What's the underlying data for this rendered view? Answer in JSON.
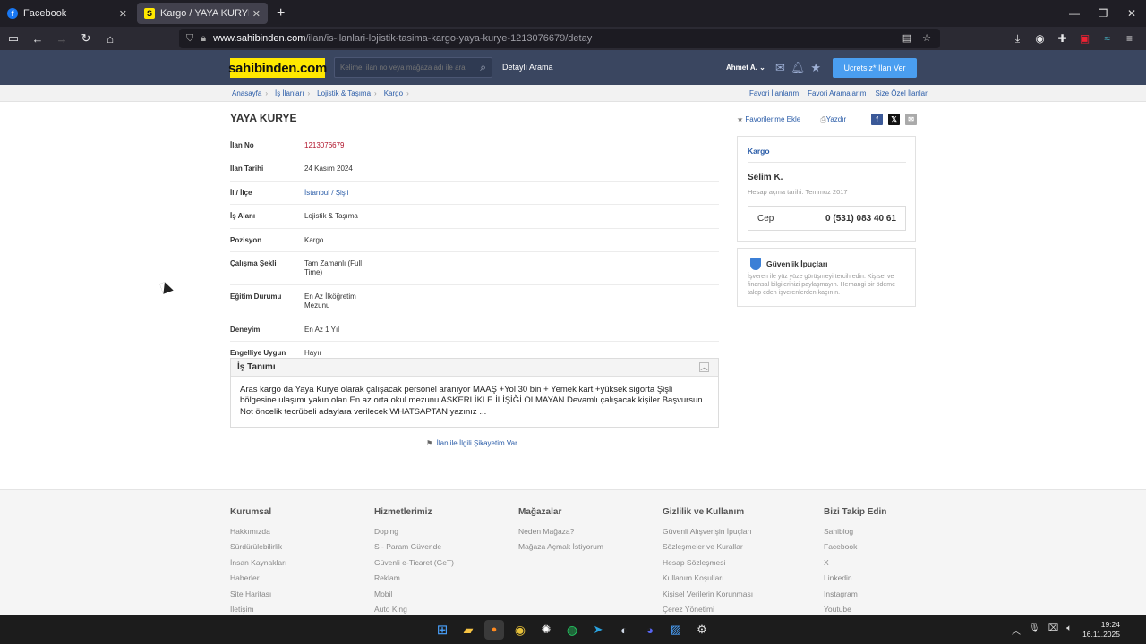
{
  "browser": {
    "tabs": [
      {
        "label": "Facebook",
        "favicon": "facebook-icon"
      },
      {
        "label": "Kargo / YAYA KURYE sahibinden",
        "favicon": "sahibinden-icon"
      }
    ],
    "url_host": "www.sahibinden.com",
    "url_path": "/ilan/is-ilanlari-lojistik-tasima-kargo-yaya-kurye-1213076679/detay"
  },
  "header": {
    "logo": "sahibinden.com",
    "search_placeholder": "Kelime, ilan no veya mağaza adı ile ara",
    "detailed_search": "Detaylı Arama",
    "user": "Ahmet A.",
    "post_ad": "Ücretsiz* İlan Ver"
  },
  "breadcrumb": [
    "Anasayfa",
    "İş İlanları",
    "Lojistik & Taşıma",
    "Kargo"
  ],
  "fav_links": [
    "Favori İlanlarım",
    "Favori Aramalarım",
    "Size Özel İlanlar"
  ],
  "listing": {
    "title": "YAYA KURYE",
    "add_favorite": "Favorilerime Ekle",
    "print": "Yazdır",
    "details": [
      {
        "key": "İlan No",
        "value": "1213076679"
      },
      {
        "key": "İlan Tarihi",
        "value": "24 Kasım 2024"
      },
      {
        "key": "İl / İlçe",
        "value": "İstanbul / Şişli"
      },
      {
        "key": "İş Alanı",
        "value": "Lojistik & Taşıma"
      },
      {
        "key": "Pozisyon",
        "value": "Kargo"
      },
      {
        "key": "Çalışma Şekli",
        "value": "Tam Zamanlı (Full Time)"
      },
      {
        "key": "Eğitim Durumu",
        "value": "En Az İlköğretim Mezunu"
      },
      {
        "key": "Deneyim",
        "value": "En Az 1 Yıl"
      },
      {
        "key": "Engelliye Uygun",
        "value": "Hayır"
      }
    ],
    "description_title": "İş Tanımı",
    "description": "Aras kargo da Yaya Kurye olarak çalışacak personel aranıyor MAAŞ +Yol 30 bin + Yemek kartı+yüksek sigorta Şişli bölgesine ulaşımı yakın olan En az orta okul mezunu ASKERLİKLE İLİŞİĞİ OLMAYAN Devamlı çalışacak kişiler Başvursun Not öncelik tecrübeli adaylara verilecek WHATSAPTAN yazınız ...",
    "complaint": "İlan ile İlgili Şikayetim Var"
  },
  "seller": {
    "category": "Kargo",
    "name": "Selim K.",
    "since": "Hesap açma tarihi: Temmuz 2017",
    "phone_label": "Cep",
    "phone": "0 (531) 083 40 61"
  },
  "safety": {
    "title": "Güvenlik İpuçları",
    "text": "İşveren ile yüz yüze görüşmeyi tercih edin. Kişisel ve finansal bilgilerinizi paylaşmayın. Herhangi bir ödeme talep eden işverenlerden kaçının."
  },
  "footer": [
    {
      "title": "Kurumsal",
      "links": [
        "Hakkımızda",
        "Sürdürülebilirlik",
        "İnsan Kaynakları",
        "Haberler",
        "Site Haritası",
        "İletişim"
      ]
    },
    {
      "title": "Hizmetlerimiz",
      "links": [
        "Doping",
        "S - Param Güvende",
        "Güvenli e-Ticaret (GeT)",
        "Reklam",
        "Mobil",
        "Auto King"
      ]
    },
    {
      "title": "Mağazalar",
      "links": [
        "Neden Mağaza?",
        "Mağaza Açmak İstiyorum"
      ]
    },
    {
      "title": "Gizlilik ve Kullanım",
      "links": [
        "Güvenli Alışverişin İpuçları",
        "Sözleşmeler ve Kurallar",
        "Hesap Sözleşmesi",
        "Kullanım Koşulları",
        "Kişisel Verilerin Korunması",
        "Çerez Yönetimi"
      ]
    },
    {
      "title": "Bizi Takip Edin",
      "links": [
        "Sahiblog",
        "Facebook",
        "X",
        "Linkedin",
        "Instagram",
        "Youtube"
      ]
    }
  ],
  "taskbar": {
    "time": "19:24",
    "date": "16.11.2025"
  },
  "colors": {
    "accent": "#4a9ef0",
    "header_bg": "#3a4660",
    "logo_bg": "#ffe800",
    "link": "#2a5ca8"
  }
}
